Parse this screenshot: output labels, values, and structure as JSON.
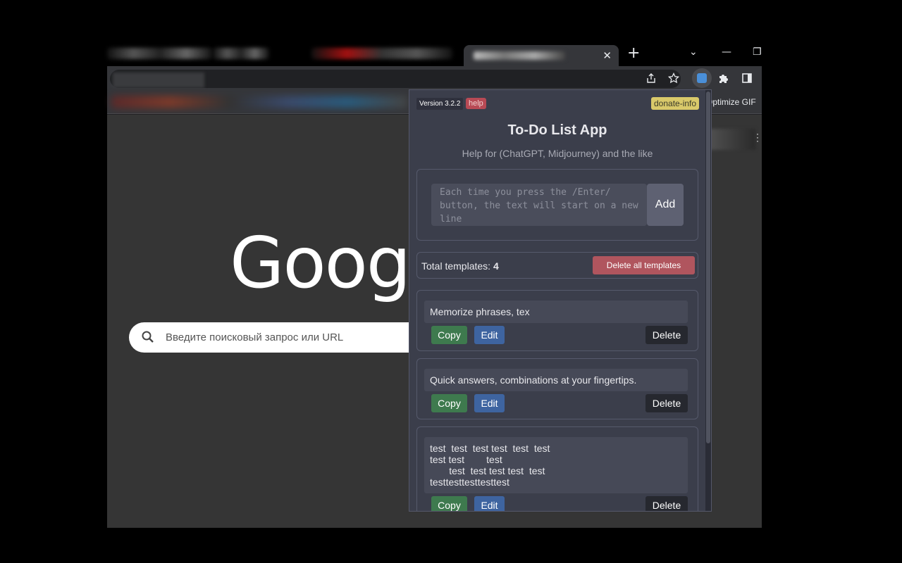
{
  "browser": {
    "tab_close": "✕",
    "new_tab": "+",
    "window_controls": {
      "dropdown": "⌄",
      "minimize": "—",
      "restore": "❐"
    },
    "bookmark_right": "Optimize GIF",
    "search_placeholder": "Введите поисковый запрос или URL",
    "google_logo_text": "Google",
    "colors": {
      "background": "#353535",
      "toolbar": "#35363a"
    }
  },
  "popup": {
    "version": "Version 3.2.2",
    "help": "help",
    "donate": "donate-info",
    "title": "To-Do List App",
    "subtitle": "Help for (ChatGPT, Midjourney) and the like",
    "input_placeholder": "Each time you press the /Enter/ button, the text will start on a new line",
    "add_label": "Add",
    "total_label": "Total templates:",
    "total_count": "4",
    "delete_all_label": "Delete all templates",
    "templates": [
      {
        "text": "Memorize phrases, tex",
        "copy": "Copy",
        "edit": "Edit",
        "delete": "Delete"
      },
      {
        "text": "Quick answers, combinations at your fingertips.",
        "copy": "Copy",
        "edit": "Edit",
        "delete": "Delete"
      },
      {
        "text": "test  test  test test  test  test\ntest test        test\n       test  test test test  test\ntesttesttesttesttest",
        "copy": "Copy",
        "edit": "Edit",
        "delete": "Delete"
      }
    ],
    "colors": {
      "copy": "#3e7a4e",
      "edit": "#3e64a0",
      "delete": "#26282f",
      "delete_all": "#b0555e",
      "help": "#b84a55",
      "donate": "#d9c96a"
    }
  }
}
